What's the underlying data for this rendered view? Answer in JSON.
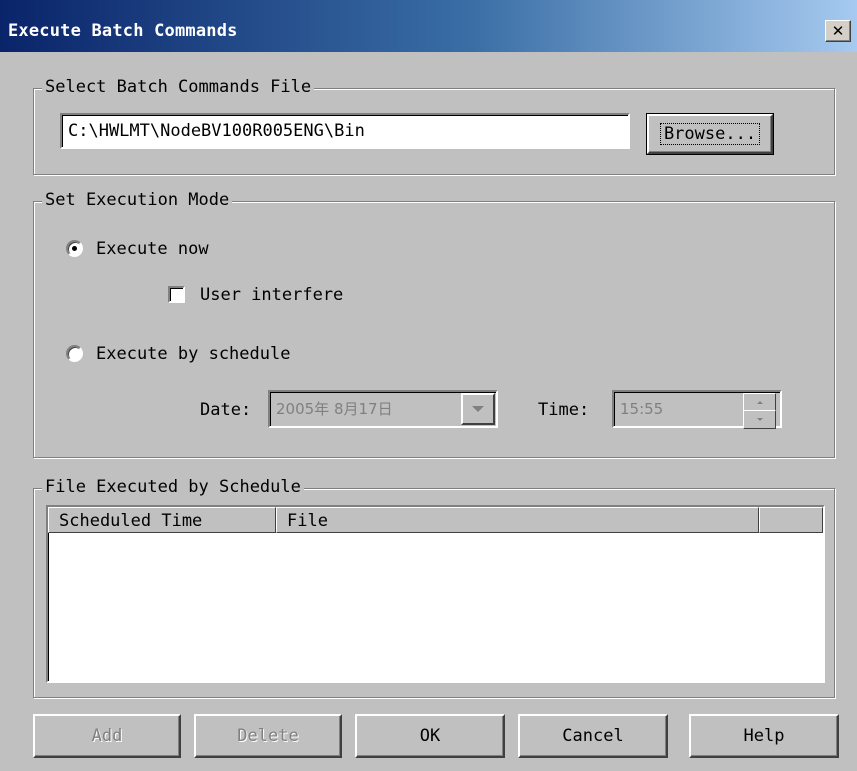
{
  "window": {
    "title": "Execute Batch Commands",
    "close_symbol": "✕"
  },
  "file_group": {
    "title": "Select Batch Commands File",
    "path_value": "C:\\HWLMT\\NodeBV100R005ENG\\Bin",
    "browse_label": "Browse..."
  },
  "mode_group": {
    "title": "Set Execution Mode",
    "execute_now_label": "Execute now",
    "execute_now_selected": true,
    "user_interfere_label": "User interfere",
    "user_interfere_checked": false,
    "execute_schedule_label": "Execute by schedule",
    "execute_schedule_selected": false,
    "date_label": "Date:",
    "date_value": "2005年 8月17日",
    "time_label": "Time:",
    "time_value": "15:55"
  },
  "schedule_group": {
    "title": "File Executed by Schedule",
    "columns": [
      "Scheduled Time",
      "File",
      ""
    ],
    "rows": []
  },
  "buttons": {
    "add": "Add",
    "delete": "Delete",
    "ok": "OK",
    "cancel": "Cancel",
    "help": "Help"
  },
  "icons": {
    "close": "close-icon",
    "combo_arrow": "chevron-down-icon",
    "spin": "spin-arrows-icon"
  }
}
